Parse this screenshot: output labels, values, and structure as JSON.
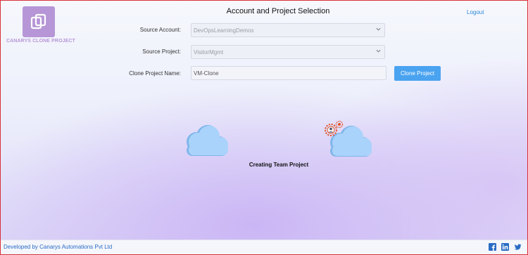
{
  "header": {
    "logo_text": "CANARYS CLONE PROJECT",
    "title": "Account and Project Selection",
    "logout_label": "Logout"
  },
  "form": {
    "source_account_label": "Source Account:",
    "source_account_value": "DevOpsLearningDemos",
    "source_project_label": "Source Project:",
    "source_project_value": "VisitorMgmt",
    "clone_name_label": "Clone Project Name:",
    "clone_name_value": "VM-Clone",
    "clone_button_label": "Clone Project"
  },
  "status": {
    "text": "Creating Team Project"
  },
  "footer": {
    "text": "Developed by Canarys Automations Pvt Ltd",
    "social_icons": [
      "facebook-icon",
      "linkedin-icon",
      "twitter-icon"
    ]
  },
  "colors": {
    "accent": "#4aa3f0",
    "logo": "#b696d6",
    "cloud": "#a9d3fb",
    "border": "#d9303b"
  }
}
